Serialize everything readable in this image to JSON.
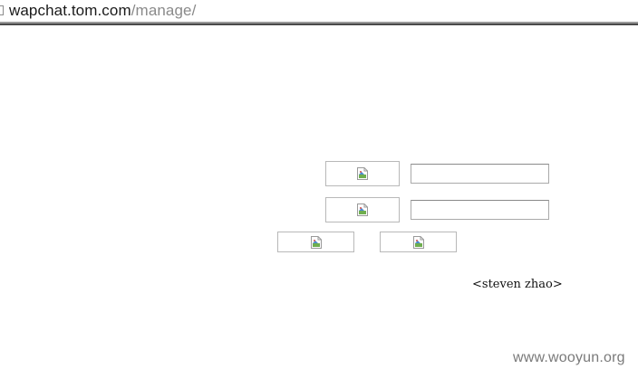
{
  "address_bar": {
    "host": "wapchat.tom.com",
    "path": "/manage/"
  },
  "login_form": {
    "username_label_image": "broken-image-icon",
    "password_label_image": "broken-image-icon",
    "username_value": "",
    "password_value": "",
    "submit_image": "broken-image-icon",
    "reset_image": "broken-image-icon"
  },
  "credit": "<steven zhao>",
  "watermark": "www.wooyun.org",
  "colors": {
    "placeholder_border": "#b8b8b8",
    "input_border": "#a9a9a9",
    "url_path": "#8a8a8a"
  }
}
